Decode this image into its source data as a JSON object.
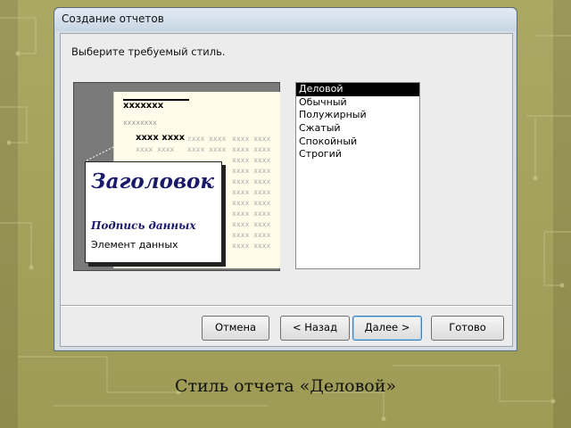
{
  "window": {
    "title": "Создание отчетов",
    "prompt": "Выберите требуемый стиль."
  },
  "preview": {
    "header_mark": "xxxxxxx",
    "sub_mark": "xxxxxxxx",
    "group_mark": "xxxx xxxx",
    "row_mark": "xxxx xxxx",
    "zoom_title": "Заголовок",
    "zoom_caption": "Подпись данных",
    "zoom_element": "Элемент данных"
  },
  "style_list": {
    "items": [
      "Деловой",
      "Обычный",
      "Полужирный",
      "Сжатый",
      "Спокойный",
      "Строгий"
    ],
    "selected_index": 0
  },
  "buttons": {
    "cancel": "Отмена",
    "back": "< Назад",
    "next": "Далее >",
    "finish": "Готово"
  },
  "slide_caption": "Стиль отчета «Деловой»",
  "colors": {
    "slide_background": "#a19f5b",
    "selection": "#000000",
    "title_ink": "#1a1a6a"
  }
}
